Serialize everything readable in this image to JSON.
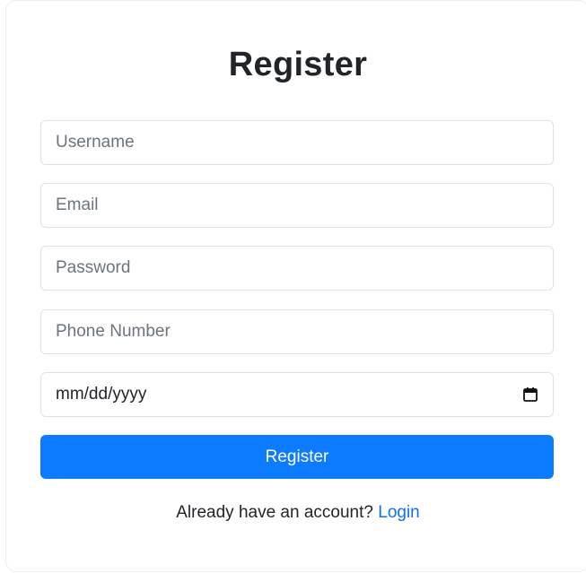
{
  "form": {
    "title": "Register",
    "username_placeholder": "Username",
    "email_placeholder": "Email",
    "password_placeholder": "Password",
    "phone_placeholder": "Phone Number",
    "date_placeholder": "mm/dd/yyyy",
    "submit_label": "Register",
    "footer_text": "Already have an account?",
    "login_link": "Login"
  },
  "colors": {
    "accent": "#0d7bff",
    "link": "#0d6efd",
    "text": "#212529",
    "placeholder": "#6c757d",
    "border": "#dee2e6"
  },
  "icons": {
    "date_picker": "calendar-icon"
  }
}
